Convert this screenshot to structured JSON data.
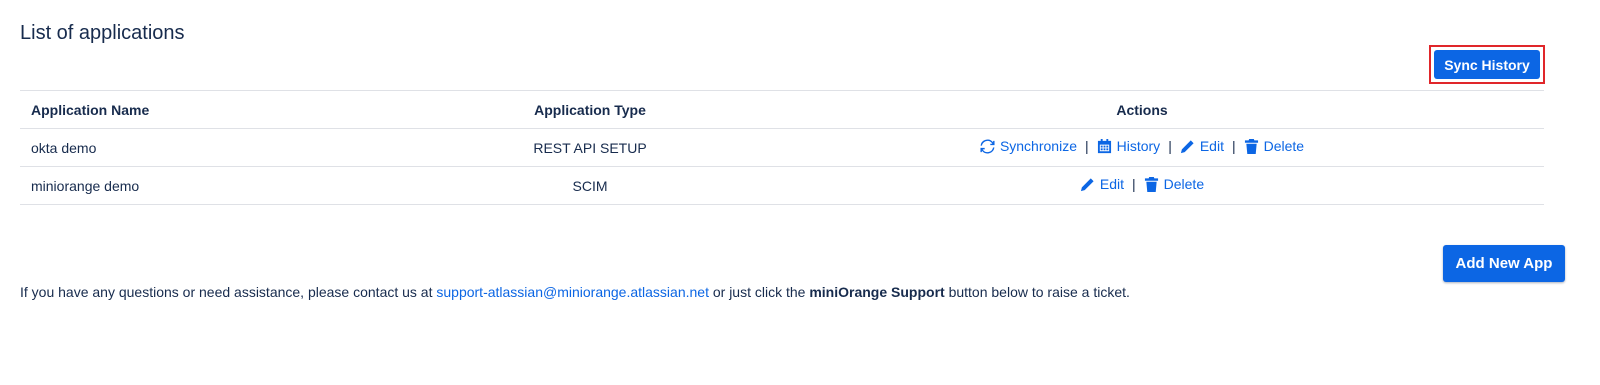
{
  "page": {
    "title": "List of applications"
  },
  "toolbar": {
    "sync_history_label": "Sync History",
    "add_new_app_label": "Add New App"
  },
  "table": {
    "headers": {
      "name": "Application Name",
      "type": "Application Type",
      "actions": "Actions"
    },
    "rows": [
      {
        "name": "okta demo",
        "type": "REST API SETUP",
        "actions": {
          "synchronize": "Synchronize",
          "history": "History",
          "edit": "Edit",
          "delete": "Delete",
          "sep": "|"
        }
      },
      {
        "name": "miniorange demo",
        "type": "SCIM",
        "actions": {
          "edit": "Edit",
          "delete": "Delete",
          "sep": "|"
        }
      }
    ]
  },
  "help": {
    "prefix": "If you have any questions or need assistance, please contact us at ",
    "email": "support-atlassian@miniorange.atlassian.net",
    "middle": " or just click the ",
    "support_name": "miniOrange Support",
    "suffix": " button below to raise a ticket."
  },
  "icons": {
    "synchronize": "sync-icon",
    "history": "calendar-icon",
    "edit": "pencil-icon",
    "delete": "trash-icon"
  },
  "colors": {
    "primary": "#0c66e4",
    "highlight_border": "#e0262a",
    "text": "#172b4d",
    "row_border": "#dfe1e6"
  }
}
